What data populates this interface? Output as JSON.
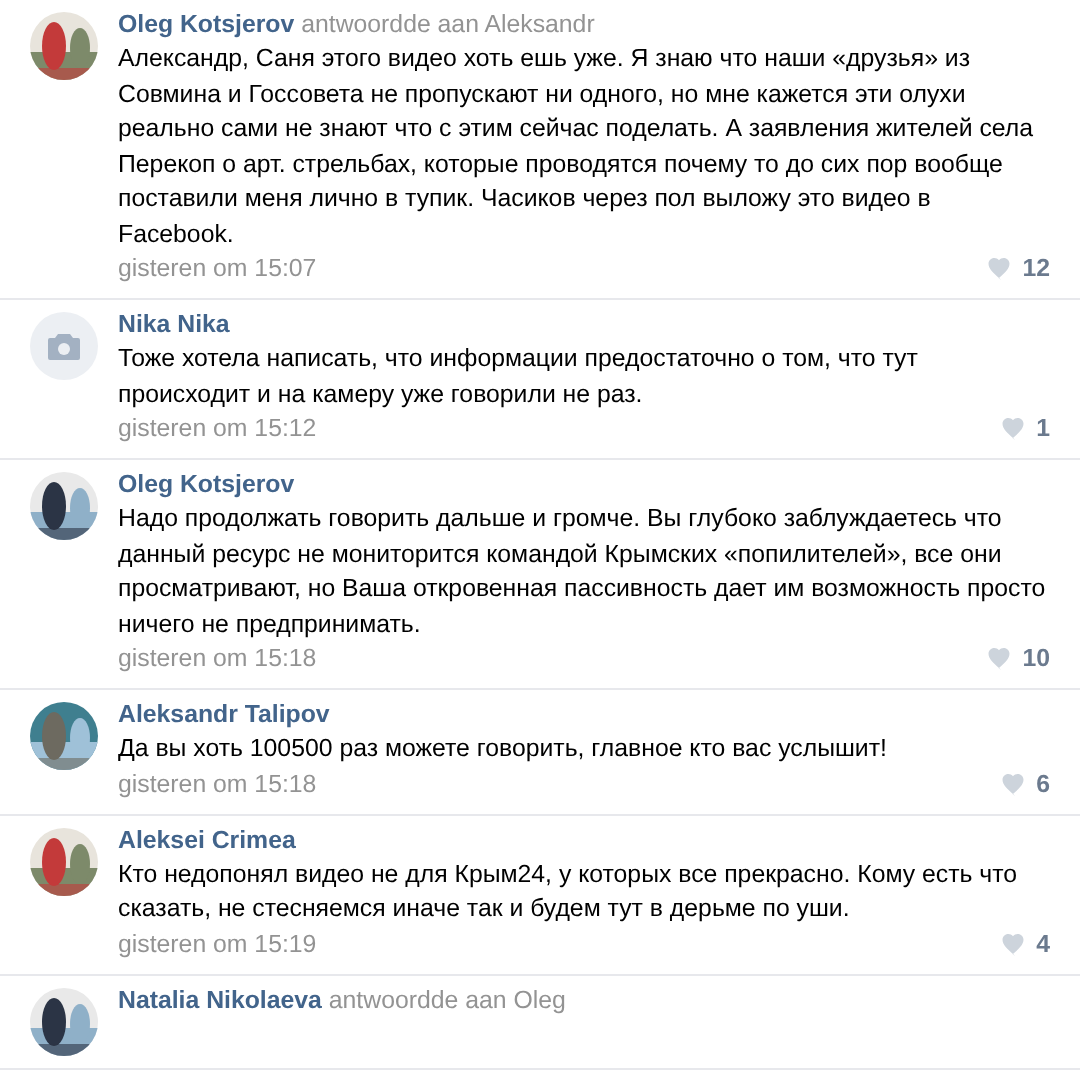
{
  "comments": [
    {
      "kind": "picture",
      "author": "Oleg Kotsjerov",
      "reply": "antwoordde aan Aleksandr",
      "text": "Александр, Саня этого видео хоть ешь уже. Я знаю что наши «друзья» из Совмина и Госсовета не пропускают ни одного, но мне кажется эти олухи реально сами не знают что с этим сейчас поделать. А заявления жителей села Перекоп о арт. стрельбах, которые проводятся почему то до сих пор вообще поставили меня лично в тупик. Часиков через пол выложу это видео в Facebook.",
      "time": "gisteren om 15:07",
      "likes": "12"
    },
    {
      "kind": "placeholder",
      "author": "Nika Nika",
      "text": "Тоже хотела написать, что информации предостаточно о том, что тут происходит и на камеру уже говорили не раз.",
      "time": "gisteren om 15:12",
      "likes": "1"
    },
    {
      "kind": "picture",
      "author": "Oleg Kotsjerov",
      "text": "Надо продолжать говорить дальше и громче. Вы глубоко заблуждаетесь что данный ресурс не мониторится командой Крымских «попилителей», все они просматривают, но Ваша откровенная пассивность дает им возможность просто ничего не предпринимать.",
      "time": "gisteren om 15:18",
      "likes": "10"
    },
    {
      "kind": "picture",
      "author": "Aleksandr Talipov",
      "text": "Да вы хоть 100500 раз можете говорить, главное кто вас услышит!",
      "time": "gisteren om 15:18",
      "likes": "6"
    },
    {
      "kind": "picture",
      "author": "Aleksei Crimea",
      "text": "Кто недопонял видео не для Крым24, у которых все прекрасно. Кому есть что сказать, не стесняемся иначе так и будем тут в дерьме по уши.",
      "time": "gisteren om 15:19",
      "likes": "4"
    },
    {
      "kind": "picture",
      "author": "Natalia Nikolaeva",
      "reply": "antwoordde aan Oleg"
    }
  ]
}
